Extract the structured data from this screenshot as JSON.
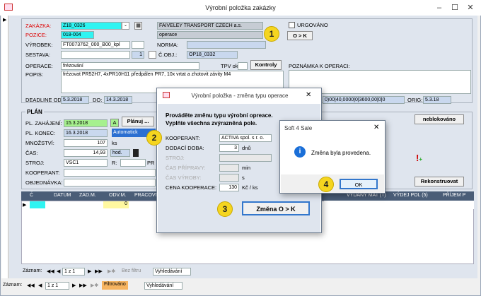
{
  "window": {
    "title": "Výrobní položka zakázky",
    "min": "–",
    "max": "☐",
    "close": "✕"
  },
  "form": {
    "zakazka_label": "ZAKÁZKA:",
    "zakazka_value": "Z18_0326",
    "pozice_label": "POZICE:",
    "pozice_value": "018-004",
    "vyrobek_label": "VÝROBEK:",
    "vyrobek_value": "FT0073762_000_B00_kpl",
    "sestava_label": "SESTAVA:",
    "sestava_num": "1",
    "customer": "FAIVELEY TRANSPORT CZECH a.s.",
    "operace_box": "operace",
    "norma_label": "NORMA:",
    "cobj_label": "Č.OBJ.:",
    "cobj_value": "OP18_0332",
    "urgovano_label": "URGOVÁNO",
    "o_k_button": "O > K",
    "operace_label": "OPERACE:",
    "operace_value": "frézování",
    "tpv_label": "TPV ok:",
    "kontroly_button": "Kontroly",
    "popis_label": "POPIS:",
    "popis_value": "frézovat PR52H7, 4xPR10H11 předpálen PR7, 10x vrtat a zhotovit závity  M4",
    "poznamka_label": "POZNÁMKA K OPERACI:",
    "deadline_label": "DEADLINE OD",
    "deadline_od": "5.3.2018",
    "do_label": "DO:",
    "deadline_do": "14.3.2018",
    "code_string": "0)00|40,0000|0|3600,00|0|0",
    "orig_label": "ORIG:",
    "orig_value": "5.3.18"
  },
  "plan": {
    "title": "PLÁN",
    "zahajeni_label": "PL. ZAHÁJENÍ:",
    "zahajeni_value": "15.3.2018",
    "a_button": "A",
    "planuj_button": "Plánuj ...",
    "konec_label": "PL. KONEC:",
    "konec_value": "16.3.2018",
    "automaticky": "Automatick",
    "mnozstvi_label": "MNOŽSTVÍ:",
    "mnozstvi_value": "107",
    "mnozstvi_unit": "ks",
    "cas_label": "ČAS:",
    "cas_value": "14,93",
    "cas_unit": "hod.",
    "stroj_label": "STROJ:",
    "stroj_value": "VSC1",
    "r_label": "R:",
    "pr_label": "PR",
    "kooperant_label": "KOOPERANT:",
    "objednavka_label": "OBJEDNÁVKA:",
    "neblokovano_button": "neblokováno",
    "rekonstruovat_button": "Rekonstruovat"
  },
  "grid": {
    "headers": [
      "Č",
      "DATUM",
      "ZAD.M.",
      "ODV.M.",
      "PRACOVN",
      "VYDANÝ MAT (T)",
      "VÝDEJ POL (5)",
      "PŘÍJEM P"
    ],
    "row_value": "0"
  },
  "nav_inner": {
    "label": "Záznam:",
    "first": "◀◀",
    "prev": "◀",
    "pos": "1 z 1",
    "next": "▶",
    "last": "▶▶",
    "new": "▶✱",
    "filter": "Bez filtru",
    "search": "Vyhledávání"
  },
  "nav_outer": {
    "label": "Záznam:",
    "first": "◀◀",
    "prev": "◀",
    "pos": "1 z 1",
    "next": "▶",
    "last": "▶▶",
    "new": "▶✱",
    "filter": "Filtrováno",
    "search": "Vyhledávání"
  },
  "dialog1": {
    "title": "Výrobní položka - změna typu operace",
    "close": "✕",
    "instruction": "Prováděte změnu typu výrobní opreace. Vyplňte všechna zvýrazněná pole.",
    "kooperant_label": "KOOPERANT:",
    "kooperant_value": "ACTIVA spol. s r. o.",
    "doba_label": "DODACÍ DOBA:",
    "doba_value": "3",
    "doba_unit": "dnů",
    "stroj_label": "STROJ:",
    "pripravy_label": "ČAS PŘÍPRAVY:",
    "pripravy_unit": "min",
    "vyroby_label": "ČAS VÝROBY:",
    "vyroby_unit": "s",
    "cena_label": "CENA KOOPERACE:",
    "cena_value": "130",
    "cena_unit": "Kč / ks",
    "zmena_button": "Změna O > K"
  },
  "dialog2": {
    "title": "Soft 4 Sale",
    "close": "✕",
    "message": "Změna byla provedena.",
    "ok_button": "OK",
    "info_glyph": "i"
  },
  "callouts": {
    "c1": "1",
    "c2": "2",
    "c3": "3",
    "c4": "4"
  },
  "colors": {
    "accent_cyan": "#2ff4f2",
    "accent_green": "#a6f08e",
    "callout": "#f5d51f",
    "grid_header": "#4a5d77",
    "info": "#1a6fd8"
  }
}
